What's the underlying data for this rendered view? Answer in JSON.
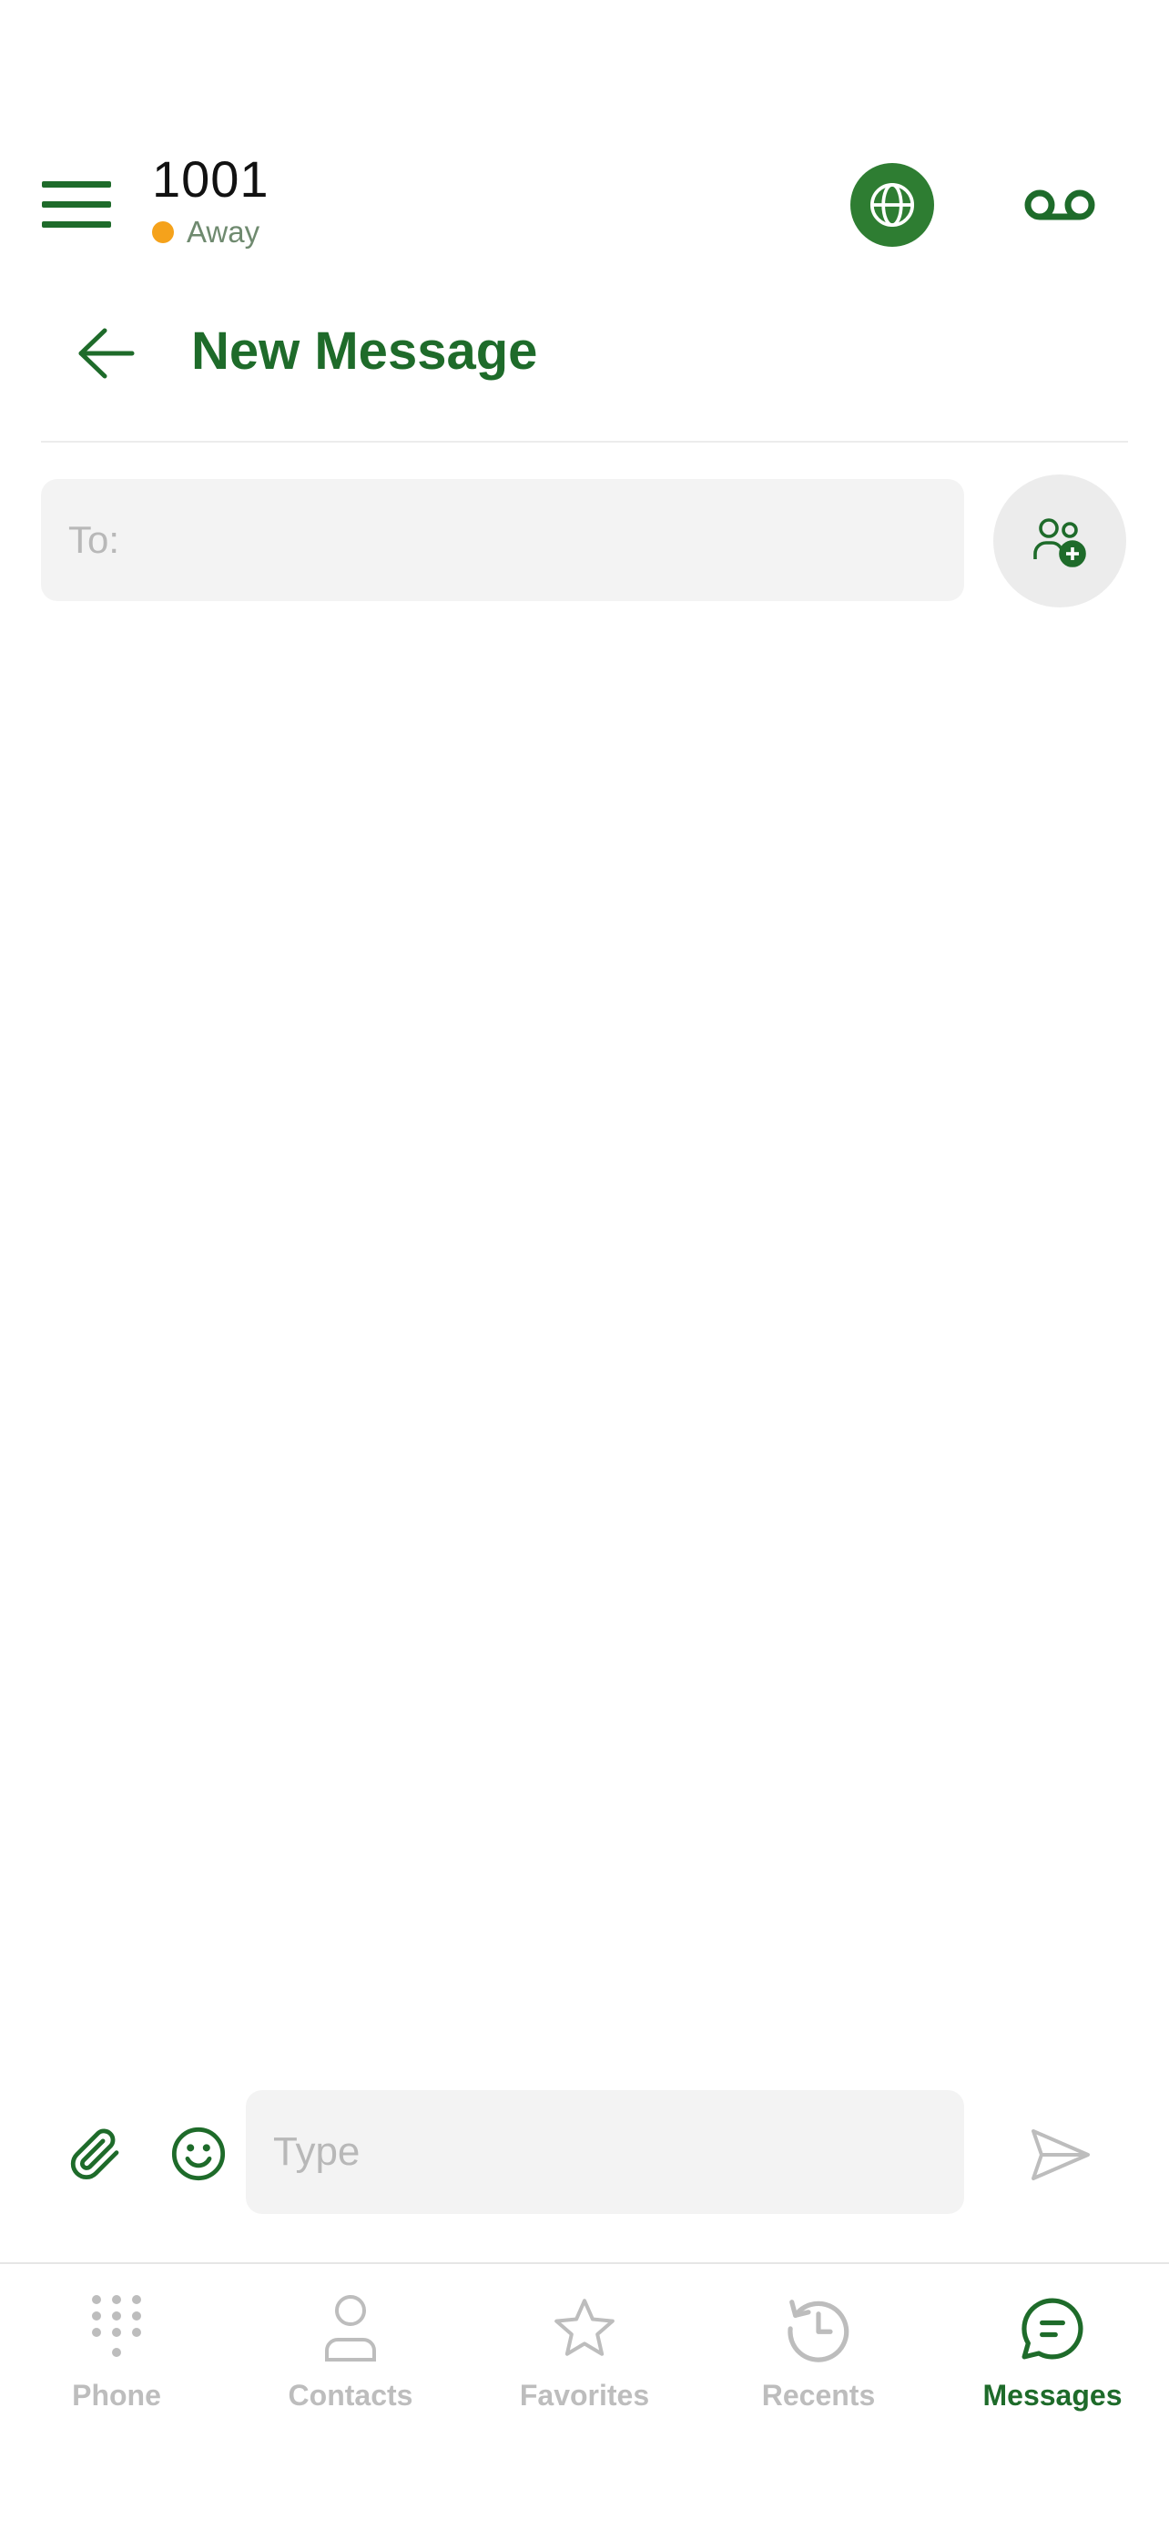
{
  "header": {
    "extension": "1001",
    "status": "Away",
    "status_color": "#f5a21b",
    "menu_icon": "hamburger-menu-icon",
    "globe_icon": "globe-icon",
    "voicemail_icon": "voicemail-icon"
  },
  "page": {
    "title": "New Message",
    "back_icon": "arrow-left-icon"
  },
  "recipient": {
    "placeholder": "To:",
    "value": "",
    "add_icon": "add-contact-icon"
  },
  "composer": {
    "placeholder": "Type",
    "value": "",
    "attach_icon": "paperclip-icon",
    "emoji_icon": "smiley-icon",
    "send_icon": "send-icon"
  },
  "nav": {
    "items": [
      {
        "label": "Phone",
        "icon": "dialpad-icon",
        "active": false
      },
      {
        "label": "Contacts",
        "icon": "person-icon",
        "active": false
      },
      {
        "label": "Favorites",
        "icon": "star-icon",
        "active": false
      },
      {
        "label": "Recents",
        "icon": "history-icon",
        "active": false
      },
      {
        "label": "Messages",
        "icon": "chat-bubble-icon",
        "active": true
      }
    ]
  },
  "colors": {
    "brand_green": "#1e6b2a",
    "globe_green": "#2e7d32",
    "inactive_gray": "#bdbdbd",
    "input_bg": "#f3f3f3"
  }
}
